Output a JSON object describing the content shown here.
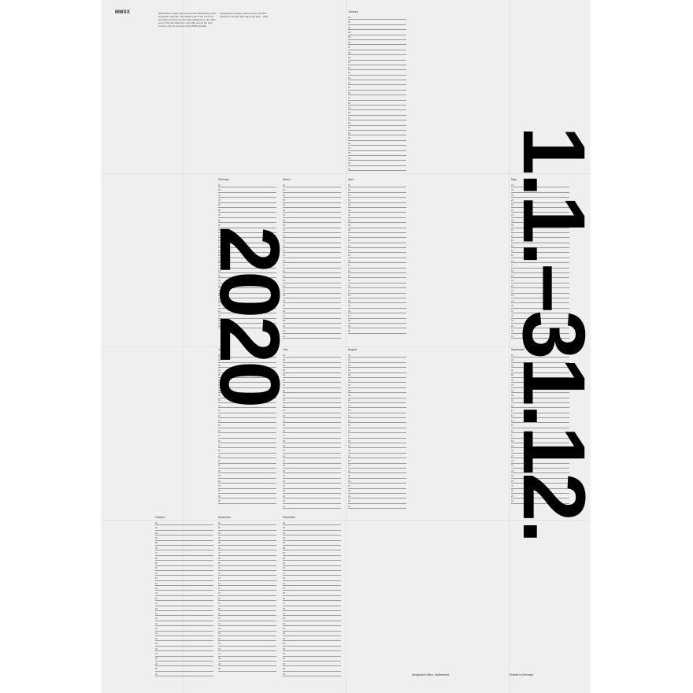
{
  "poster": {
    "label": "MMXX",
    "intro_col1": "2020 will be a leap year and the 21st Wednesday of the Gregorian calendar. The 2020th year of the Common Era (CE) and Anno Domini (AD) designations, the 20th year of the 3rd millennium, the 20th year of the 21st century, and the 1st year of the 2020s decade.",
    "intro_col2": "Designed by Rudiger Kuhne, Poster Number: ... Typeset in Circular, Elo Light & 30 and ... Well",
    "year_text": "2020",
    "range_text": "1.1.–31.12.",
    "footer_left": "Designed in Bern, Switzerland",
    "footer_right": "Printed in Germany",
    "months": [
      {
        "name": "January",
        "days": 31
      },
      {
        "name": "February",
        "days": 29
      },
      {
        "name": "March",
        "days": 31
      },
      {
        "name": "April",
        "days": 30
      },
      {
        "name": "May",
        "days": 31
      },
      {
        "name": "June",
        "days": 30
      },
      {
        "name": "July",
        "days": 31
      },
      {
        "name": "August",
        "days": 31
      },
      {
        "name": "September",
        "days": 30
      },
      {
        "name": "October",
        "days": 31
      },
      {
        "name": "November",
        "days": 30
      },
      {
        "name": "December",
        "days": 31
      }
    ]
  }
}
